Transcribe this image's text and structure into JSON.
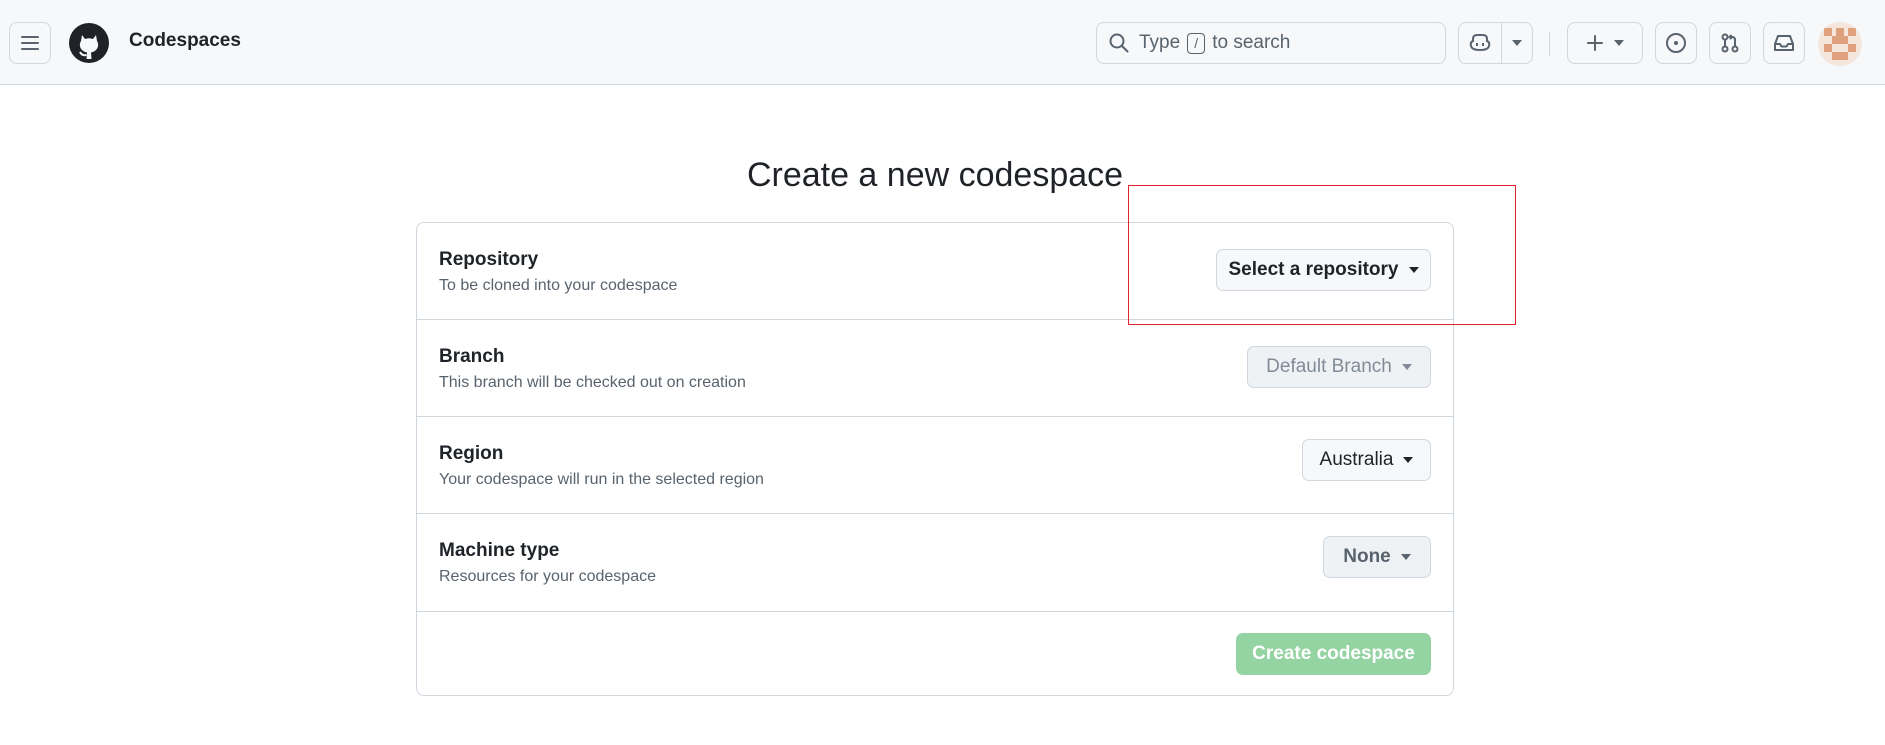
{
  "header": {
    "app_title": "Codespaces",
    "search": {
      "prefix": "Type",
      "key": "/",
      "suffix": "to search"
    },
    "icons": [
      "menu-icon",
      "github-logo-icon",
      "search-icon",
      "copilot-icon",
      "plus-icon",
      "issues-icon",
      "pull-request-icon",
      "inbox-icon"
    ]
  },
  "page": {
    "title": "Create a new codespace"
  },
  "form": {
    "rows": [
      {
        "label": "Repository",
        "description": "To be cloned into your codespace",
        "dropdown": "Select a repository"
      },
      {
        "label": "Branch",
        "description": "This branch will be checked out on creation",
        "dropdown": "Default Branch"
      },
      {
        "label": "Region",
        "description": "Your codespace will run in the selected region",
        "dropdown": "Australia"
      },
      {
        "label": "Machine type",
        "description": "Resources for your codespace",
        "dropdown": "None"
      }
    ],
    "submit_label": "Create codespace"
  },
  "colors": {
    "accent_disabled_green": "#94d3a2",
    "highlight_box": "#e0242f",
    "header_bg": "#f6f8fa"
  }
}
